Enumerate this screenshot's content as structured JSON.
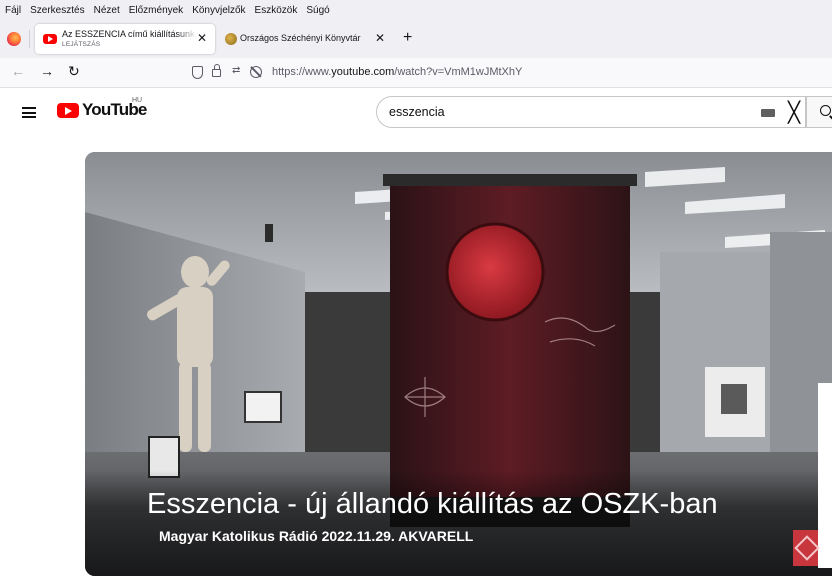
{
  "menubar": {
    "items": [
      "Fájl",
      "Szerkesztés",
      "Nézet",
      "Előzmények",
      "Könyvjelzők",
      "Eszközök",
      "Súgó"
    ]
  },
  "tabs": [
    {
      "title": "Az ESSZENCIA című kiállításunk",
      "subtitle": "LEJÁTSZÁS",
      "icon": "youtube-favicon",
      "active": true
    },
    {
      "title": "Országos Széchényi Könyvtár",
      "icon": "oszk-favicon",
      "active": false
    }
  ],
  "navbar": {
    "url_prefix": "https://www.",
    "url_domain": "youtube.com",
    "url_path": "/watch?v=VmM1wJMtXhY"
  },
  "youtube": {
    "brand": "YouTube",
    "country": "HU",
    "search_value": "esszencia"
  },
  "video": {
    "title": "Esszencia - új állandó kiállítás az OSZK-ban",
    "subtitle": "Magyar Katolikus Rádió 2022.11.29. AKVARELL"
  },
  "colors": {
    "youtube_red": "#ff0000",
    "browser_chrome": "#f0f0f4",
    "accent_red": "#c8363e"
  }
}
